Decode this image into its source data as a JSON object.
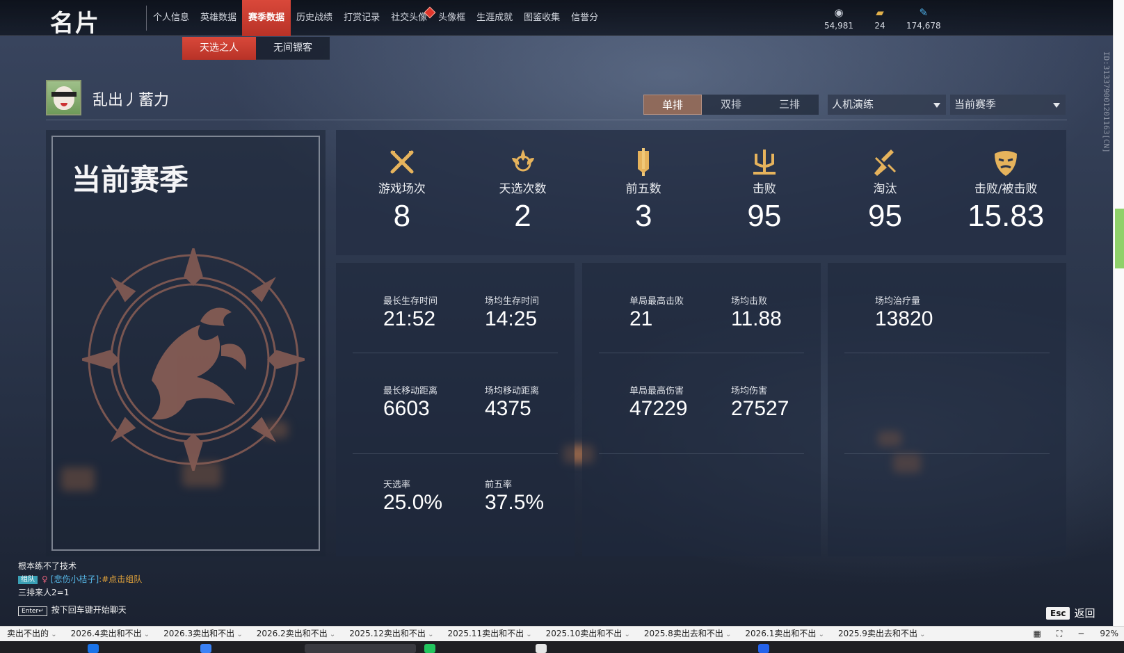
{
  "app": {
    "title": "名片"
  },
  "nav": {
    "items": [
      "个人信息",
      "英雄数据",
      "赛季数据",
      "历史战绩",
      "打赏记录",
      "社交头像",
      "头像框",
      "生涯成就",
      "图鉴收集",
      "信誉分"
    ],
    "active_index": 2,
    "notify_index": 5
  },
  "currencies": [
    {
      "icon": "coin-icon",
      "value": "54,981"
    },
    {
      "icon": "ticket-icon",
      "value": "24"
    },
    {
      "icon": "feather-icon",
      "value": "174,678"
    }
  ],
  "player_id": "ID:313379001201163[CN]",
  "subtabs": {
    "items": [
      "天选之人",
      "无间镖客"
    ],
    "active_index": 0
  },
  "player": {
    "name": "乱出丿蓄力"
  },
  "modes": {
    "items": [
      "单排",
      "双排",
      "三排"
    ],
    "active_index": 0
  },
  "filters": {
    "mode_select": "人机演练",
    "season_select": "当前赛季"
  },
  "season_card": {
    "title": "当前赛季"
  },
  "summary_stats": [
    {
      "icon": "crossed-swords-icon",
      "label": "游戏场次",
      "value": "8"
    },
    {
      "icon": "lotus-crest-icon",
      "label": "天选次数",
      "value": "2"
    },
    {
      "icon": "banner-icon",
      "label": "前五数",
      "value": "3"
    },
    {
      "icon": "trident-icon",
      "label": "击败",
      "value": "95"
    },
    {
      "icon": "broken-blade-icon",
      "label": "淘汰",
      "value": "95"
    },
    {
      "icon": "mask-icon",
      "label": "击败/被击败",
      "value": "15.83"
    }
  ],
  "panels": {
    "survival": [
      {
        "label": "最长生存时间",
        "value": "21:52"
      },
      {
        "label": "场均生存时间",
        "value": "14:25"
      },
      {
        "label": "最长移动距离",
        "value": "6603"
      },
      {
        "label": "场均移动距离",
        "value": "4375"
      },
      {
        "label": "天选率",
        "value": "25.0%"
      },
      {
        "label": "前五率",
        "value": "37.5%"
      }
    ],
    "combat": [
      {
        "label": "单局最高击败",
        "value": "21"
      },
      {
        "label": "场均击败",
        "value": "11.88"
      },
      {
        "label": "单局最高伤害",
        "value": "47229"
      },
      {
        "label": "场均伤害",
        "value": "27527"
      }
    ],
    "support": [
      {
        "label": "场均治疗量",
        "value": "13820"
      }
    ]
  },
  "chat": {
    "line1": "根本练不了技术",
    "tag": "组队",
    "player": "[悲伤小桔子]",
    "action": ":#点击组队",
    "line3": "三排来人2=1",
    "enter_key": "Enter↵",
    "hint": "按下回车键开始聊天"
  },
  "esc": {
    "key": "Esc",
    "label": "返回"
  },
  "bookmarks": {
    "items": [
      "卖出不出的",
      "2026.4卖出和不出",
      "2026.3卖出和不出",
      "2026.2卖出和不出",
      "2025.12卖出和不出",
      "2025.11卖出和不出",
      "2025.10卖出和不出",
      "2025.8卖出去和不出",
      "2026.1卖出和不出",
      "2025.9卖出去和不出"
    ],
    "zoom": "92%"
  }
}
